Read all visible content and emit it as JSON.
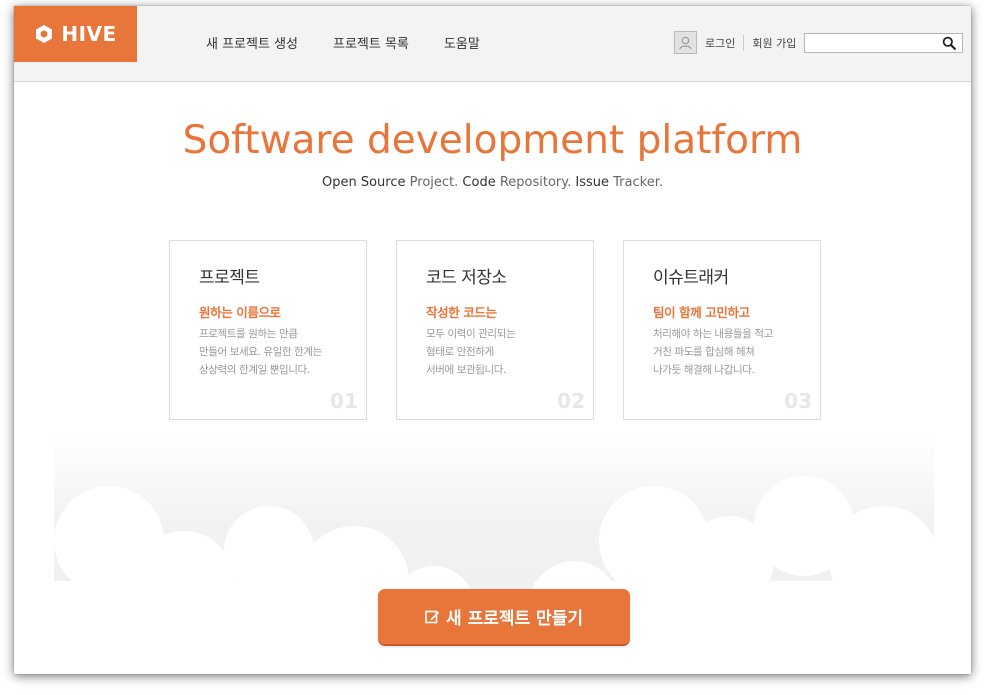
{
  "header": {
    "logo_text": "HIVE",
    "nav": [
      {
        "label": "새 프로젝트 생성"
      },
      {
        "label": "프로젝트 목록"
      },
      {
        "label": "도움말"
      }
    ],
    "login_label": "로그인",
    "signup_label": "회원 가입",
    "search_placeholder": "",
    "search_value": ""
  },
  "hero": {
    "title": "Software development platform",
    "subtitle_parts": [
      "Open Source",
      "Project.",
      "Code",
      "Repository.",
      "Issue",
      "Tracker."
    ]
  },
  "cards": [
    {
      "title": "프로젝트",
      "subtitle": "원하는 이름으로",
      "lines": [
        "프로젝트를 원하는 만큼",
        "만들어 보세요. 유일한 한계는",
        "상상력의 한계일 뿐입니다."
      ],
      "number": "01"
    },
    {
      "title": "코드 저장소",
      "subtitle": "작성한 코드는",
      "lines": [
        "모두 이력이 관리되는",
        "형태로 안전하게",
        "서버에 보관됩니다."
      ],
      "number": "02"
    },
    {
      "title": "이슈트래커",
      "subtitle": "팀이 함께 고민하고",
      "lines": [
        "처리해야 하는 내용들을 적고",
        "거친 파도를 합심해 헤쳐",
        "나가듯 해결해 나갑니다."
      ],
      "number": "03"
    }
  ],
  "cta": {
    "label": "새 프로젝트 만들기",
    "icon": "edit-icon"
  },
  "colors": {
    "brand": "#e8753a",
    "topbar_bg": "#f3f3f3",
    "text": "#333333",
    "muted": "#999999"
  }
}
